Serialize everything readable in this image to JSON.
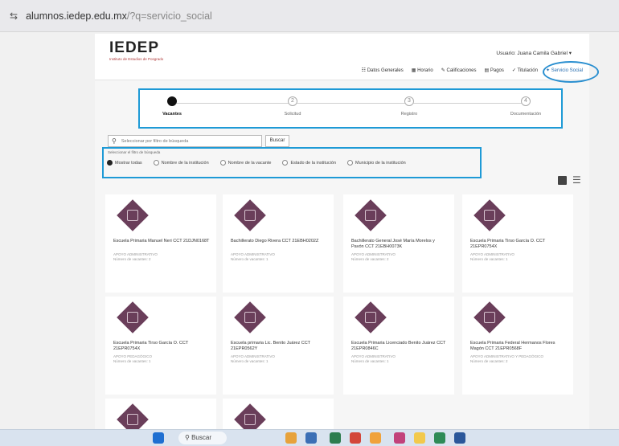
{
  "browser": {
    "url_host": "alumnos.iedep.edu.mx",
    "url_path": "/?q=servicio_social"
  },
  "header": {
    "logo": "IEDEP",
    "logo_subtitle": "Instituto de Estudios de Posgrado",
    "user": "Usuario: Juana Camila Gabriel",
    "nav": [
      "Datos Generales",
      "Horario",
      "Calificaciones",
      "Pagos",
      "Titulación",
      "Servicio Social"
    ]
  },
  "stepper": {
    "steps": [
      {
        "label": "Vacantes",
        "number": "1",
        "active": true
      },
      {
        "label": "Solicitud",
        "number": "2",
        "active": false
      },
      {
        "label": "Registro",
        "number": "3",
        "active": false
      },
      {
        "label": "Documentación",
        "number": "4",
        "active": false
      }
    ]
  },
  "search": {
    "placeholder": "Seleccionar por filtro de búsqueda",
    "button": "Buscar"
  },
  "filters": {
    "label": "Seleccionar el filtro de búsqueda",
    "options": [
      {
        "label": "Mostrar todas",
        "checked": true
      },
      {
        "label": "Nombre de la institución",
        "checked": false
      },
      {
        "label": "Nombre de la vacante",
        "checked": false
      },
      {
        "label": "Estado de la institución",
        "checked": false
      },
      {
        "label": "Municipio de la institución",
        "checked": false
      }
    ]
  },
  "cards": [
    {
      "name": "Escuela Primaria Manuel Neri CCT 21DJN0168T",
      "meta1": "APOYO ADMINISTRATIVO",
      "meta2": "Número de vacantes: 2"
    },
    {
      "name": "Bachillerato Diego Rivera CCT 21EBH0202Z",
      "meta1": "APOYO ADMINISTRATIVO",
      "meta2": "Número de vacantes: 1"
    },
    {
      "name": "Bachillerato General José María Morelos y Pavón CCT 21EBH0073K",
      "meta1": "APOYO ADMINISTRATIVO",
      "meta2": "Número de vacantes: 2"
    },
    {
      "name": "Escuela Primaria Tirso García O. CCT 21EPR0754X",
      "meta1": "APOYO ADMINISTRATIVO",
      "meta2": "Número de vacantes: 1"
    },
    {
      "name": "Escuela Primaria Tirso García O. CCT 21EPR0754X",
      "meta1": "APOYO PEDAGÓGICO",
      "meta2": "Número de vacantes: 1"
    },
    {
      "name": "Escuela primaria Lic. Benito Juárez CCT 21EPR0562Y",
      "meta1": "APOYO ADMINISTRATIVO",
      "meta2": "Número de vacantes: 1"
    },
    {
      "name": "Escuela Primaria Licenciado Benito Juárez CCT 21EPR0846C",
      "meta1": "APOYO ADMINISTRATIVO",
      "meta2": "Número de vacantes: 1"
    },
    {
      "name": "Escuela Primaria Federal Hermanos Flores Magón CCT 21EPR0568F",
      "meta1": "APOYO ADMINISTRATIVO Y PEDAGÓGICO",
      "meta2": "Número de vacantes: 2"
    }
  ],
  "taskbar": {
    "search_label": "Buscar"
  },
  "colors": {
    "card_icon": "#6a3e5a",
    "highlight": "#1e9ad6",
    "nav_active": "#2a6fb0"
  }
}
